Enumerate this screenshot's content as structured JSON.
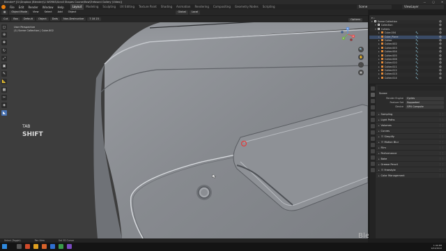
{
  "window": {
    "title": "Blender* [G:\\Dropbox (Blender)\\1 WORKS\\Scroll Shapes Course\\Raw\\Trefosoni Gallery (Video)]",
    "controls": [
      "—",
      "▢",
      "✕"
    ]
  },
  "menubar": {
    "items": [
      "File",
      "Edit",
      "Render",
      "Window",
      "Help"
    ],
    "workspaces": [
      "Layout",
      "Modeling",
      "Sculpting",
      "UV Editing",
      "Texture Paint",
      "Shading",
      "Animation",
      "Rendering",
      "Compositing",
      "Geometry Nodes",
      "Scripting"
    ],
    "active_workspace": "Layout",
    "scene": "Scene",
    "view_layer": "ViewLayer"
  },
  "header": {
    "mode": "Object Mode",
    "menus": [
      "View",
      "Select",
      "Add",
      "Object"
    ],
    "transform_orientation": "Global",
    "pivot": "Local"
  },
  "toolheader": {
    "items": [
      "Cut",
      "Box",
      "Default",
      "Object",
      "Dots",
      "Non-Destructive",
      "7 18 23"
    ],
    "options": "Options"
  },
  "viewport": {
    "view_name": "User Perspective",
    "collection_path": "(1) Scene Collection | Cube.002",
    "key_label": "TAB",
    "modifier_key": "SHIFT",
    "axis_labels": {
      "x": "X",
      "y": "Y",
      "z": "Z"
    },
    "colors": {
      "background": "#3d3d3d",
      "surface": "#8a8d92",
      "highlight": "#bfc3c8",
      "accent": "#e03c3c"
    }
  },
  "toolbar": {
    "tools": [
      "select-icon",
      "cursor-icon",
      "move-icon",
      "rotate-icon",
      "scale-icon",
      "transform-icon",
      "annotate-icon",
      "measure-icon",
      "add-cube-icon",
      "boxcutter-icon",
      "hardops-icon",
      "knife-icon"
    ],
    "glyphs": [
      "◻",
      "⊕",
      "✥",
      "↻",
      "⤢",
      "▣",
      "✎",
      "📐",
      "▩",
      "✂",
      "◈",
      "◣"
    ]
  },
  "navigation": {
    "buttons": [
      "🔍",
      "✋",
      "🎥",
      "▦"
    ]
  },
  "watermark": "Blenderbros.com",
  "statusbar": {
    "items": [
      "Select (Toggle)",
      "Pan View",
      "Set 3D Cursor"
    ]
  },
  "taskbar": {
    "time": "1:40 PM",
    "date": "9/12/2022"
  },
  "outliner": {
    "search_placeholder": "",
    "rows": [
      {
        "label": "Scene Collection",
        "kind": "scene",
        "indent": 0
      },
      {
        "label": "Collection",
        "kind": "coll",
        "indent": 1
      },
      {
        "label": "Cutters",
        "kind": "coll",
        "indent": 1
      },
      {
        "label": "Cube.004",
        "kind": "mesh",
        "indent": 2
      },
      {
        "label": "Cube_Plane",
        "kind": "mesh",
        "indent": 2
      },
      {
        "label": "Cutter",
        "kind": "mesh",
        "indent": 2
      },
      {
        "label": "Cutter.002",
        "kind": "mesh",
        "indent": 2
      },
      {
        "label": "Cutter.003",
        "kind": "mesh",
        "indent": 2
      },
      {
        "label": "Cutter.004",
        "kind": "mesh",
        "indent": 2
      },
      {
        "label": "Cutter.005",
        "kind": "mesh",
        "indent": 2
      },
      {
        "label": "Cutter.006",
        "kind": "mesh",
        "indent": 2
      },
      {
        "label": "Cutter.010",
        "kind": "mesh",
        "indent": 2
      },
      {
        "label": "Cutter.011",
        "kind": "mesh",
        "indent": 2
      },
      {
        "label": "Cutter.012",
        "kind": "mesh",
        "indent": 2
      },
      {
        "label": "Cutter.013",
        "kind": "mesh",
        "indent": 2
      },
      {
        "label": "Cutter.014",
        "kind": "mesh",
        "indent": 2
      }
    ]
  },
  "properties": {
    "title": "Scene",
    "fields": [
      {
        "label": "Render Engine",
        "value": "Cycles"
      },
      {
        "label": "Feature Set",
        "value": "Supported"
      },
      {
        "label": "Device",
        "value": "GPU Compute"
      }
    ],
    "panels": [
      {
        "label": "Sampling",
        "check": false
      },
      {
        "label": "Light Paths",
        "check": false
      },
      {
        "label": "Volumes",
        "check": false
      },
      {
        "label": "Curves",
        "check": false
      },
      {
        "label": "Simplify",
        "check": true
      },
      {
        "label": "Motion Blur",
        "check": true
      },
      {
        "label": "Film",
        "check": false
      },
      {
        "label": "Performance",
        "check": false
      },
      {
        "label": "Bake",
        "check": false
      },
      {
        "label": "Grease Pencil",
        "check": false
      },
      {
        "label": "Freestyle",
        "check": true
      },
      {
        "label": "Color Management",
        "check": false
      }
    ]
  }
}
